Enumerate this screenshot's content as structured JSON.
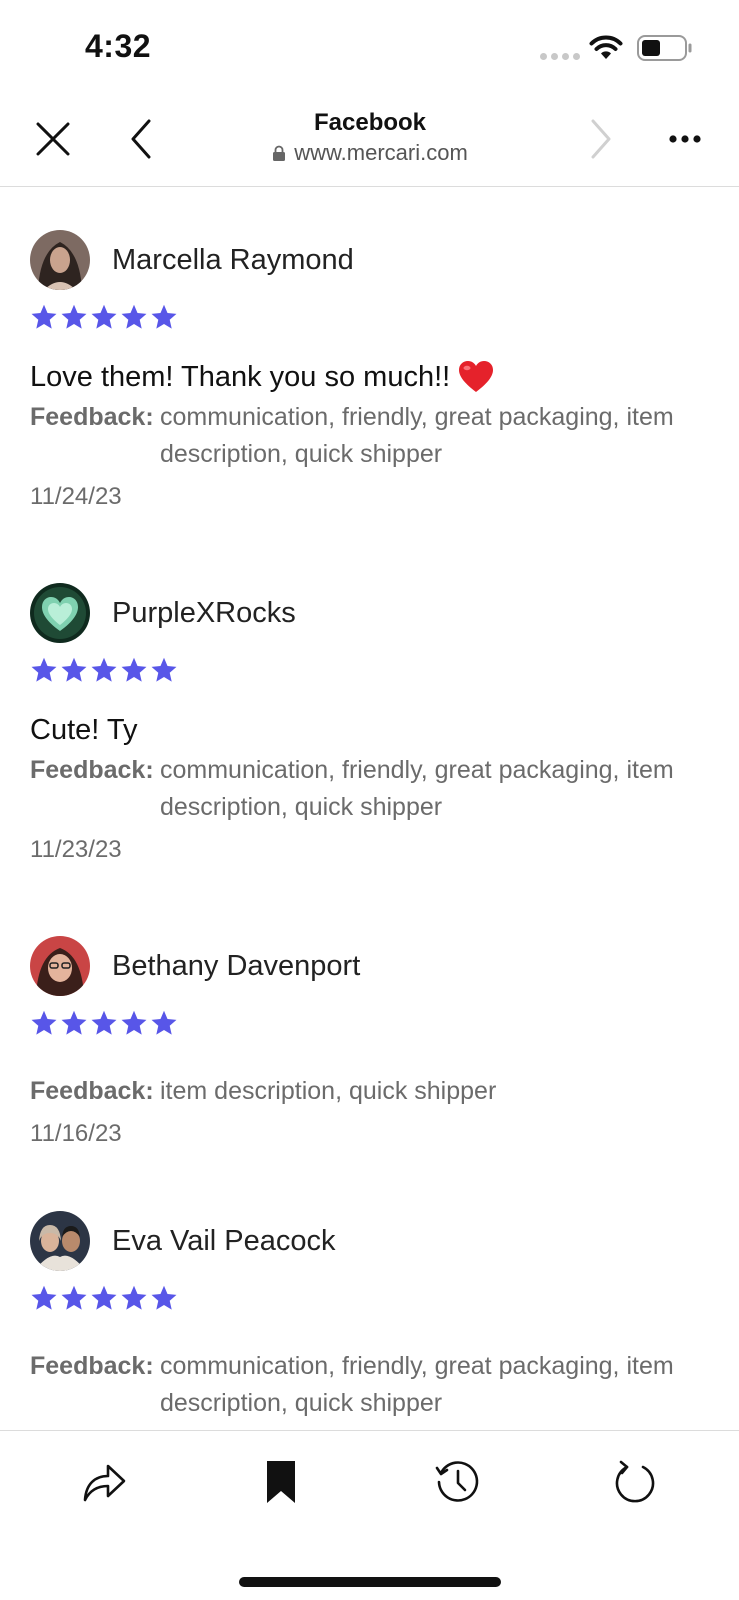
{
  "status_bar": {
    "time": "4:32",
    "wifi_icon": "wifi-icon",
    "battery_icon": "battery-icon"
  },
  "nav": {
    "title": "Facebook",
    "url": "www.mercari.com",
    "icons": [
      "close-icon",
      "back-icon",
      "forward-icon",
      "more-icon",
      "lock-icon"
    ]
  },
  "reviews": [
    {
      "name": "Marcella Raymond",
      "rating": 5,
      "comment": "Love them! Thank you so much!!",
      "comment_emoji": "heart-icon",
      "feedback_label": "Feedback:",
      "feedback": "communication, friendly, great packaging, item description, quick shipper",
      "date": "11/24/23"
    },
    {
      "name": "PurpleXRocks",
      "rating": 5,
      "comment": "Cute! Ty",
      "feedback_label": "Feedback:",
      "feedback": "communication, friendly, great packaging, item description, quick shipper",
      "date": "11/23/23"
    },
    {
      "name": "Bethany Davenport",
      "rating": 5,
      "feedback_label": "Feedback:",
      "feedback": "item description, quick shipper",
      "date": "11/16/23"
    },
    {
      "name": "Eva Vail Peacock",
      "rating": 5,
      "feedback_label": "Feedback:",
      "feedback": "communication, friendly, great packaging, item description, quick shipper"
    }
  ],
  "toolbar": {
    "icons": [
      "share-icon",
      "bookmark-icon",
      "history-icon",
      "refresh-icon"
    ]
  },
  "colors": {
    "star": "#5856e8",
    "muted_text": "#6b6b6b",
    "divider": "#dcdcdc"
  }
}
